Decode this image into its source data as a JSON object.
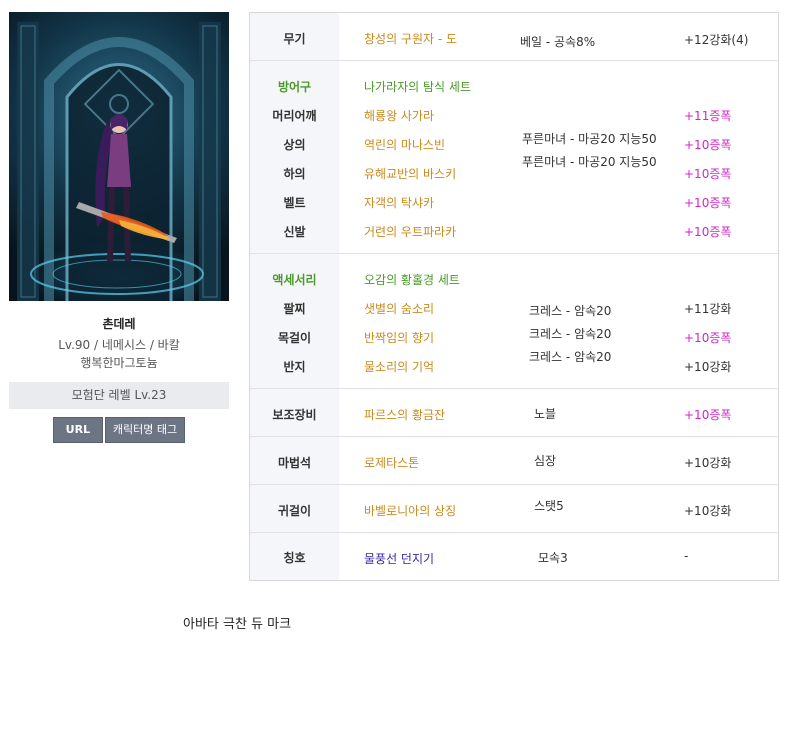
{
  "profile": {
    "name": "촌데레",
    "info": "Lv.90 / 네메시스 / 바칼",
    "guild": "행복한마그토늄",
    "adventure_level": "모험단 레벨 Lv.23",
    "url_button": "URL",
    "tag_button": "캐릭터명 태그"
  },
  "equipment": {
    "weapon": {
      "label": "무기",
      "item": "창성의 구원자 - 도",
      "option": "베일 - 공속8%",
      "enhance": "+12강화(4)"
    },
    "armor": {
      "section": "방어구",
      "set_name": "나가라자의 탐식 세트",
      "option_1": "푸른마녀 - 마공20 지능50",
      "option_2": "푸른마녀 - 마공20 지능50",
      "items": [
        {
          "label": "머리어깨",
          "item": "해룡왕 사가라",
          "enhance": "+11증폭"
        },
        {
          "label": "상의",
          "item": "역린의 마나스빈",
          "enhance": "+10증폭"
        },
        {
          "label": "하의",
          "item": "유해교반의 바스키",
          "enhance": "+10증폭"
        },
        {
          "label": "벨트",
          "item": "자객의 탁샤카",
          "enhance": "+10증폭"
        },
        {
          "label": "신발",
          "item": "거련의 우트파라카",
          "enhance": "+10증폭"
        }
      ]
    },
    "accessory": {
      "section": "액세서리",
      "set_name": "오감의 황홀경 세트",
      "items": [
        {
          "label": "팔찌",
          "item": "샛별의 숨소리",
          "option": "크레스 - 암속20",
          "enhance": "+11강화"
        },
        {
          "label": "목걸이",
          "item": "반짝임의 향기",
          "option": "크레스 - 암속20",
          "enhance": "+10증폭"
        },
        {
          "label": "반지",
          "item": "물소리의 기억",
          "option": "크레스 - 암속20",
          "enhance": "+10강화"
        }
      ]
    },
    "sub": {
      "label": "보조장비",
      "item": "파르스의 황금잔",
      "option": "노블",
      "enhance": "+10증폭"
    },
    "magicstone": {
      "label": "마법석",
      "item": "로제타스톤",
      "option": "심장",
      "enhance": "+10강화"
    },
    "earring": {
      "label": "귀걸이",
      "item": "바벨로니아의 상징",
      "option": "스탯5",
      "enhance": "+10강화"
    },
    "title": {
      "label": "칭호",
      "item": "물풍선 던지기",
      "option": "모속3",
      "enhance": "-"
    }
  },
  "footer": {
    "text": "아바타 극찬 듀 마크"
  },
  "colors": {
    "item": "#c98a1e",
    "set": "#4a9a2a",
    "amplify": "#d126c7",
    "title_item": "#3b2aa0",
    "button": "#6b7584"
  }
}
